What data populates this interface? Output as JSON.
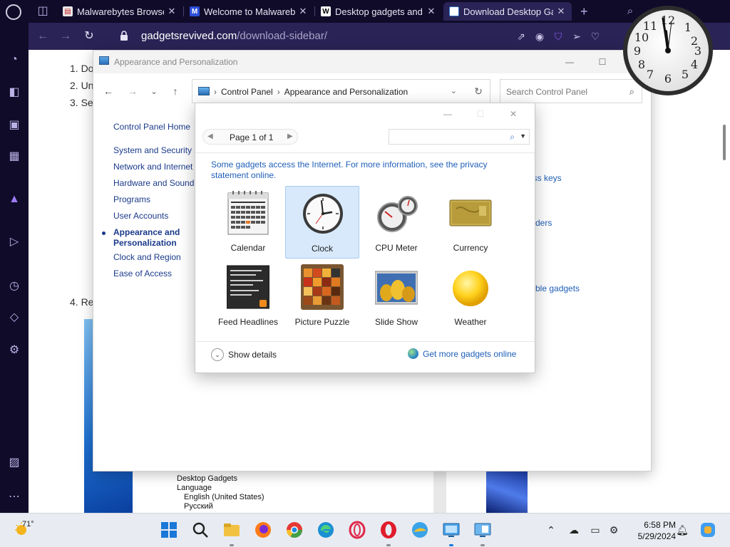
{
  "browser": {
    "tabs": [
      {
        "title": "Malwarebytes Browser G",
        "close": "✕"
      },
      {
        "title": "Welcome to Malwareby",
        "close": "✕"
      },
      {
        "title": "Desktop gadgets and s",
        "close": "✕"
      },
      {
        "title": "Download Desktop Gad",
        "close": "✕"
      }
    ],
    "new_tab": "+",
    "url_host": "gadgetsrevived.com",
    "url_path": "/download-sidebar/"
  },
  "webpage": {
    "list_items": [
      "1. Do",
      "2. Un",
      "3. Se",
      "4. Re"
    ],
    "tree_items": [
      "Desktop Gadgets",
      "Language",
      "English (United States)",
      "Русский"
    ]
  },
  "control_panel": {
    "window_title": "Appearance and Personalization",
    "breadcrumb": [
      "Control Panel",
      "Appearance and Personalization"
    ],
    "search_placeholder": "Search Control Panel",
    "nav_links": [
      "Control Panel Home",
      "System and Security",
      "Network and Internet",
      "Hardware and Sound",
      "Programs",
      "User Accounts",
      "Appearance and Personalization",
      "Clock and Region",
      "Ease of Access"
    ],
    "right_links": [
      "cess keys",
      "ders",
      "ble gadgets"
    ]
  },
  "gadgets_dialog": {
    "page_label": "Page 1 of 1",
    "notice": "Some gadgets access the Internet.  For more information, see the privacy statement online.",
    "gadgets": [
      {
        "name": "Calendar"
      },
      {
        "name": "Clock"
      },
      {
        "name": "CPU Meter"
      },
      {
        "name": "Currency"
      },
      {
        "name": "Feed Headlines"
      },
      {
        "name": "Picture Puzzle"
      },
      {
        "name": "Slide Show"
      },
      {
        "name": "Weather"
      }
    ],
    "selected": "Clock",
    "show_details": "Show details",
    "get_more": "Get more gadgets online"
  },
  "taskbar": {
    "temperature": "71°",
    "time": "6:58 PM",
    "date": "5/29/2024"
  },
  "colors": {
    "accent": "#2a2356",
    "link": "#1f5fb8",
    "selection": "#d7e9fb"
  }
}
